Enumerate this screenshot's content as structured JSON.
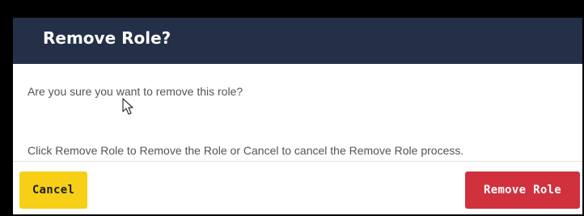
{
  "dialog": {
    "title": "Remove Role?",
    "message": "Are you sure you want to remove this role?",
    "instructions": "Click Remove Role to Remove the Role or Cancel to cancel the Remove Role process.",
    "cancel_label": "Cancel",
    "remove_label": "Remove Role"
  },
  "colors": {
    "header_bg": "#233047",
    "cancel_button": "#f6cf16",
    "remove_button": "#d1303d"
  },
  "icons": {
    "cursor": "mouse-pointer-icon"
  }
}
